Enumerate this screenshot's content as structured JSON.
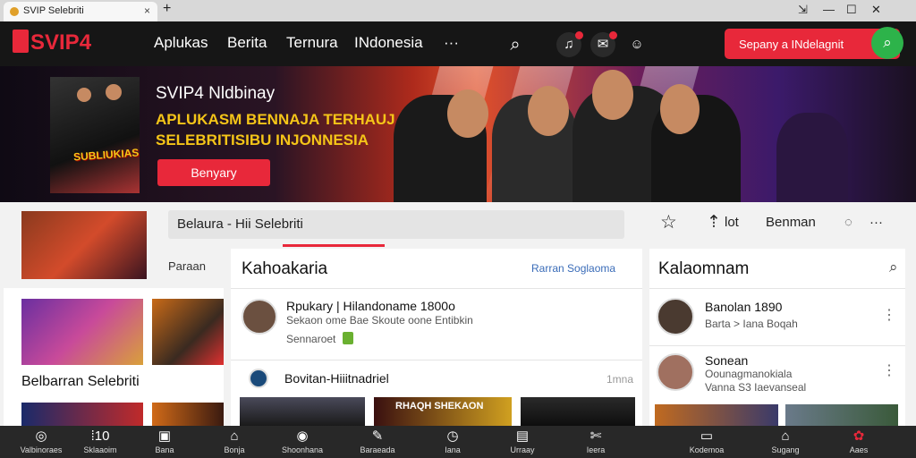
{
  "browser": {
    "tab_title": "SVIP   Selebriti",
    "tab_close": "×",
    "new_tab": "+",
    "window_controls": [
      "⇲",
      "—",
      "☐",
      "✕"
    ]
  },
  "nav": {
    "logo_text": "SVIP4",
    "links": [
      "Aplukas",
      "Berita",
      "Ternura",
      "INdonesia",
      "···"
    ],
    "search_label": "Sepany a INdelagnit",
    "icons": [
      "search-icon",
      "notification-icon",
      "chat-icon",
      "user-icon"
    ]
  },
  "hero": {
    "title": "SVIP4 Nldbinay",
    "subtitle_line1": "APLUKASM BENNAJA TERHAUJ",
    "subtitle_line2": "SELEBRITISIBU INJONNESIA",
    "button": "Benyary",
    "poster_text": "SUBLIUKIAS"
  },
  "toolbar": {
    "search_value": "Belaura  - Hii Selebriti",
    "star": "☆",
    "link_label": "lot",
    "benman": "Benman",
    "more": "···"
  },
  "left": {
    "side_label": "Paraan",
    "section_title": "Belbarran Selebriti"
  },
  "middle": {
    "title": "Kahoakaria",
    "link": "Rarran Soglaoma",
    "item1_title": "Rpukary | Hilandoname 1800o",
    "item1_sub": "Sekaon ome Bae Skoute oone Entibkin",
    "item1_meta": "Sennaroet",
    "item2_title": "Bovitan-Hiiitnadriel",
    "item2_meta": "1mna",
    "thumb_text": "RHAQH SHEKAON"
  },
  "right": {
    "title": "Kalaomnam",
    "item1_title": "Banolan 1890",
    "item1_sub": "Barta > Iana Boqah",
    "item2_title": "Sonean",
    "item2_sub1": "Oounagmanokiala",
    "item2_sub2": "Vanna S3 Iaevanseal"
  },
  "bottom_bar": [
    {
      "icon": "◎",
      "label": "Valbinoraes"
    },
    {
      "icon": "⁞10",
      "label": "Sklaaoim"
    },
    {
      "icon": "▣",
      "label": "Bana"
    },
    {
      "icon": "⌂",
      "label": "Bonja"
    },
    {
      "icon": "◉",
      "label": "Shoonhana"
    },
    {
      "icon": "✎",
      "label": "Baraeada"
    },
    {
      "icon": "◷",
      "label": "Iana"
    },
    {
      "icon": "▤",
      "label": "Urraay"
    },
    {
      "icon": "✄",
      "label": "Ieera"
    },
    {
      "icon": "▭",
      "label": "Kodemoa"
    },
    {
      "icon": "⌂",
      "label": "Sugang"
    },
    {
      "icon": "✿",
      "label": "Aaes"
    }
  ],
  "colors": {
    "accent": "#e8283a",
    "go_button": "#2db34a",
    "highlight": "#f5c518",
    "nav_bg": "#161616"
  }
}
